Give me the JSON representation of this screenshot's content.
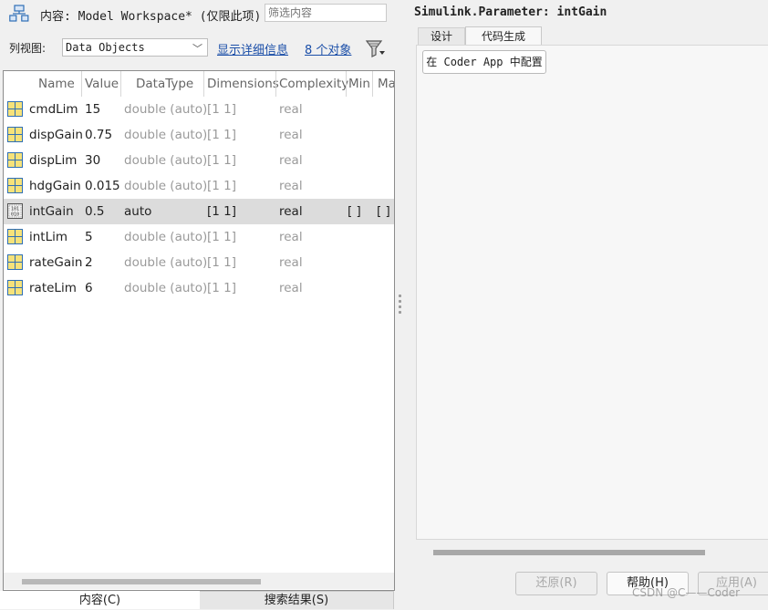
{
  "header": {
    "content_label": "内容: Model Workspace* (仅限此项)",
    "filter_placeholder": "筛选内容"
  },
  "view": {
    "label": "列视图:",
    "selected": "Data Objects",
    "details_link": "显示详细信息",
    "count_link": "8 个对象"
  },
  "table": {
    "columns": [
      "Name",
      "Value",
      "DataType",
      "Dimensions",
      "Complexity",
      "Min",
      "Ma"
    ],
    "rows": [
      {
        "name": "cmdLim",
        "value": "15",
        "datatype": "double (auto)",
        "dimensions": "[1 1]",
        "complexity": "real",
        "min": "",
        "max": "",
        "icon": "grid-icon",
        "selected": false
      },
      {
        "name": "dispGain",
        "value": "0.75",
        "datatype": "double (auto)",
        "dimensions": "[1 1]",
        "complexity": "real",
        "min": "",
        "max": "",
        "icon": "grid-icon",
        "selected": false
      },
      {
        "name": "dispLim",
        "value": "30",
        "datatype": "double (auto)",
        "dimensions": "[1 1]",
        "complexity": "real",
        "min": "",
        "max": "",
        "icon": "grid-icon",
        "selected": false
      },
      {
        "name": "hdgGain",
        "value": "0.015",
        "datatype": "double (auto)",
        "dimensions": "[1 1]",
        "complexity": "real",
        "min": "",
        "max": "",
        "icon": "grid-icon",
        "selected": false
      },
      {
        "name": "intGain",
        "value": "0.5",
        "datatype": "auto",
        "dimensions": "[1 1]",
        "complexity": "real",
        "min": "[ ]",
        "max": "[ ]",
        "icon": "binary-param-icon",
        "selected": true
      },
      {
        "name": "intLim",
        "value": "5",
        "datatype": "double (auto)",
        "dimensions": "[1 1]",
        "complexity": "real",
        "min": "",
        "max": "",
        "icon": "grid-icon",
        "selected": false
      },
      {
        "name": "rateGain",
        "value": "2",
        "datatype": "double (auto)",
        "dimensions": "[1 1]",
        "complexity": "real",
        "min": "",
        "max": "",
        "icon": "grid-icon",
        "selected": false
      },
      {
        "name": "rateLim",
        "value": "6",
        "datatype": "double (auto)",
        "dimensions": "[1 1]",
        "complexity": "real",
        "min": "",
        "max": "",
        "icon": "grid-icon",
        "selected": false
      }
    ]
  },
  "bottom_tabs": {
    "content": "内容(C)",
    "search": "搜索结果(S)"
  },
  "right": {
    "title": "Simulink.Parameter: intGain",
    "tab_design": "设计",
    "tab_codegen": "代码生成",
    "coder_button": "在 Coder App 中配置",
    "revert": "还原(R)",
    "help": "帮助(H)",
    "apply": "应用(A)",
    "watermark": "CSDN @C——Coder"
  },
  "colors": {
    "link": "#1a4ea8",
    "selected_row": "#dcdcdc",
    "icon_yellow": "#f6e27a",
    "icon_blue": "#2f6fb6"
  }
}
